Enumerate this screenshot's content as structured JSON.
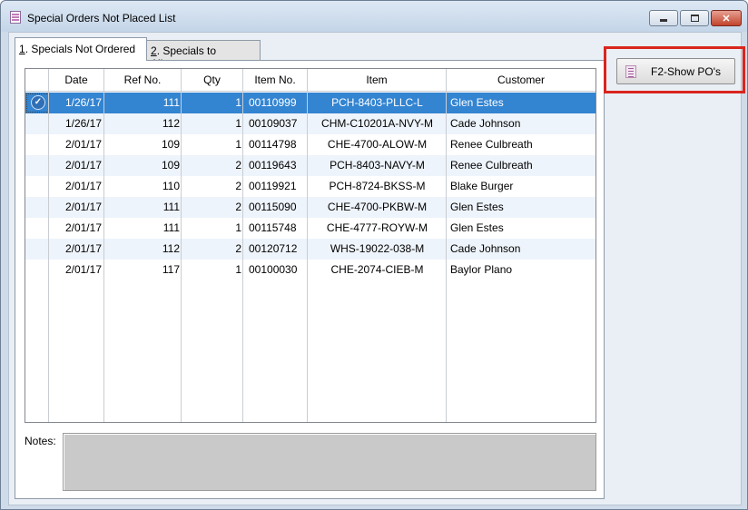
{
  "window": {
    "title": "Special Orders Not Placed List",
    "min_label": "",
    "max_label": "",
    "close_label": "✕"
  },
  "tabs": [
    {
      "key": "1",
      "label": ". Specials Not Ordered",
      "active": true
    },
    {
      "key": "2",
      "label": ". Specials to Allocate",
      "active": false
    }
  ],
  "grid": {
    "columns": [
      "",
      "Date",
      "Ref No.",
      "Qty",
      "Item No.",
      "Item",
      "Customer"
    ],
    "rows": [
      {
        "date": "1/26/17",
        "ref": "111",
        "qty": "1",
        "item_no": "00110999",
        "item": "PCH-8403-PLLC-L",
        "customer": "Glen Estes",
        "selected": true
      },
      {
        "date": "1/26/17",
        "ref": "112",
        "qty": "1",
        "item_no": "00109037",
        "item": "CHM-C10201A-NVY-M",
        "customer": "Cade Johnson"
      },
      {
        "date": "2/01/17",
        "ref": "109",
        "qty": "1",
        "item_no": "00114798",
        "item": "CHE-4700-ALOW-M",
        "customer": "Renee Culbreath"
      },
      {
        "date": "2/01/17",
        "ref": "109",
        "qty": "2",
        "item_no": "00119643",
        "item": "PCH-8403-NAVY-M",
        "customer": "Renee Culbreath"
      },
      {
        "date": "2/01/17",
        "ref": "110",
        "qty": "2",
        "item_no": "00119921",
        "item": "PCH-8724-BKSS-M",
        "customer": "Blake Burger"
      },
      {
        "date": "2/01/17",
        "ref": "111",
        "qty": "2",
        "item_no": "00115090",
        "item": "CHE-4700-PKBW-M",
        "customer": "Glen Estes"
      },
      {
        "date": "2/01/17",
        "ref": "111",
        "qty": "1",
        "item_no": "00115748",
        "item": "CHE-4777-ROYW-M",
        "customer": "Glen Estes"
      },
      {
        "date": "2/01/17",
        "ref": "112",
        "qty": "2",
        "item_no": "00120712",
        "item": "WHS-19022-038-M",
        "customer": "Cade Johnson"
      },
      {
        "date": "2/01/17",
        "ref": "117",
        "qty": "1",
        "item_no": "00100030",
        "item": "CHE-2074-CIEB-M",
        "customer": "Baylor Plano"
      }
    ]
  },
  "notes": {
    "label": "Notes:",
    "value": ""
  },
  "actions": {
    "show_pos_label": "F2-Show PO's"
  },
  "colors": {
    "selection": "#3384d1",
    "highlight_border": "#d9251d"
  }
}
